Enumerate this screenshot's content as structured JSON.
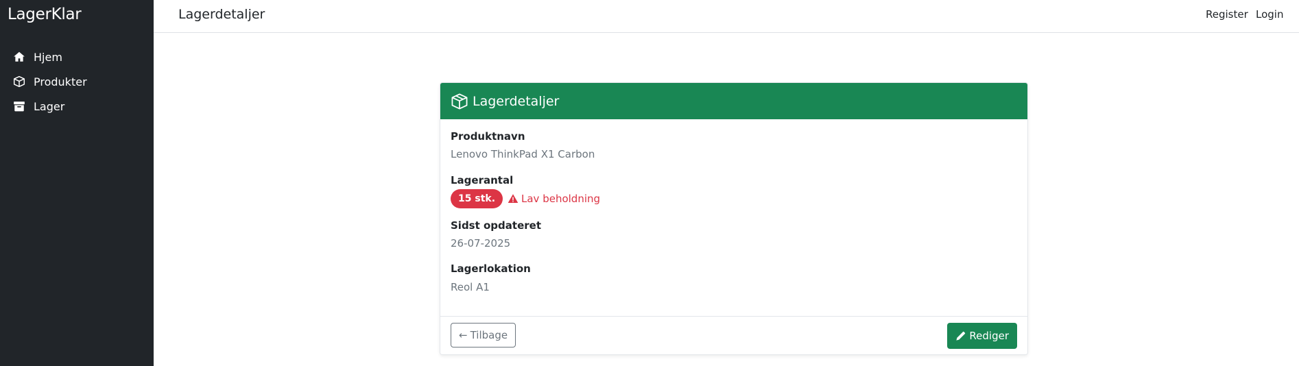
{
  "app": {
    "brand": "LagerKlar"
  },
  "sidebar": {
    "items": [
      {
        "label": "Hjem",
        "icon": "house-icon"
      },
      {
        "label": "Produkter",
        "icon": "box-icon"
      },
      {
        "label": "Lager",
        "icon": "archive-icon"
      }
    ]
  },
  "topbar": {
    "title": "Lagerdetaljer",
    "register_label": "Register",
    "login_label": "Login"
  },
  "card": {
    "title": "Lagerdetaljer",
    "header_icon": "box-icon",
    "header_color": "#198754",
    "fields": {
      "product_name_label": "Produktnavn",
      "product_name_value": "Lenovo ThinkPad X1 Carbon",
      "stock_label": "Lagerantal",
      "stock_badge": "15 stk.",
      "stock_warning": "Lav beholdning",
      "updated_label": "Sidst opdateret",
      "updated_value": "26-07-2025",
      "location_label": "Lagerlokation",
      "location_value": "Reol A1"
    },
    "footer": {
      "back_label": "Tilbage",
      "edit_label": "Rediger"
    }
  },
  "colors": {
    "sidebar_bg": "#212529",
    "success": "#198754",
    "danger": "#dc3545",
    "muted": "#6c757d"
  }
}
